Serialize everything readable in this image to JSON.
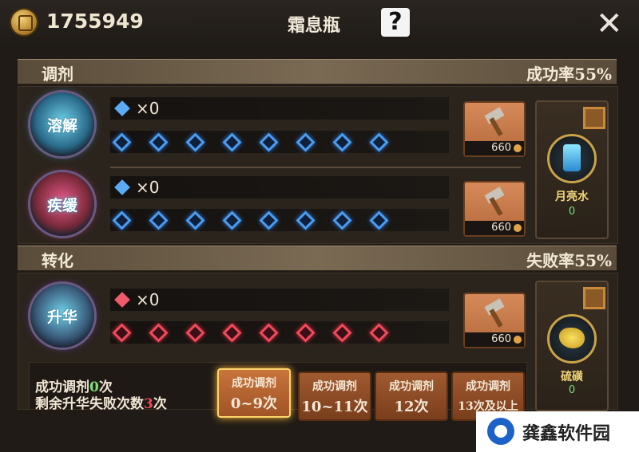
{
  "header": {
    "currency_value": "1755949",
    "title": "霜息瓶",
    "help_label": "?",
    "close_label": "✕"
  },
  "brew_section": {
    "label": "调剂",
    "rate_label": "成功率55%",
    "potions": [
      {
        "orb_label": "溶解",
        "gem_count": "×0",
        "cost": "660",
        "slots_filled": 0,
        "slots_total": 8
      },
      {
        "orb_label": "疾缓",
        "gem_count": "×0",
        "cost": "660",
        "slots_filled": 0,
        "slots_total": 8
      }
    ],
    "material": {
      "name": "月亮水",
      "count": "0"
    }
  },
  "transform_section": {
    "label": "转化",
    "rate_label": "失败率55%",
    "potion": {
      "orb_label": "升华",
      "gem_count": "×0",
      "cost": "660",
      "slots_filled": 0,
      "slots_total": 8
    },
    "material": {
      "name": "硫磺",
      "count": "0"
    }
  },
  "stats": {
    "success_prefix": "成功调剂",
    "success_count": "0",
    "success_suffix": "次",
    "fail_prefix": "剩余升华失败次数",
    "fail_count": "3",
    "fail_suffix": "次"
  },
  "tabs": [
    {
      "top": "成功调剂",
      "bottom": "0~9次",
      "selected": true
    },
    {
      "top": "成功调剂",
      "bottom": "10~11次",
      "selected": false
    },
    {
      "top": "成功调剂",
      "bottom": "12次",
      "selected": false
    },
    {
      "top": "成功调剂",
      "bottom": "13次及以上",
      "selected": false
    }
  ],
  "watermark": {
    "text": "龚鑫软件园"
  },
  "colors": {
    "accent_green": "#7fe07a",
    "accent_red": "#f04a5a",
    "blue_gem": "#4a9cf0",
    "red_gem": "#f04a5a"
  }
}
